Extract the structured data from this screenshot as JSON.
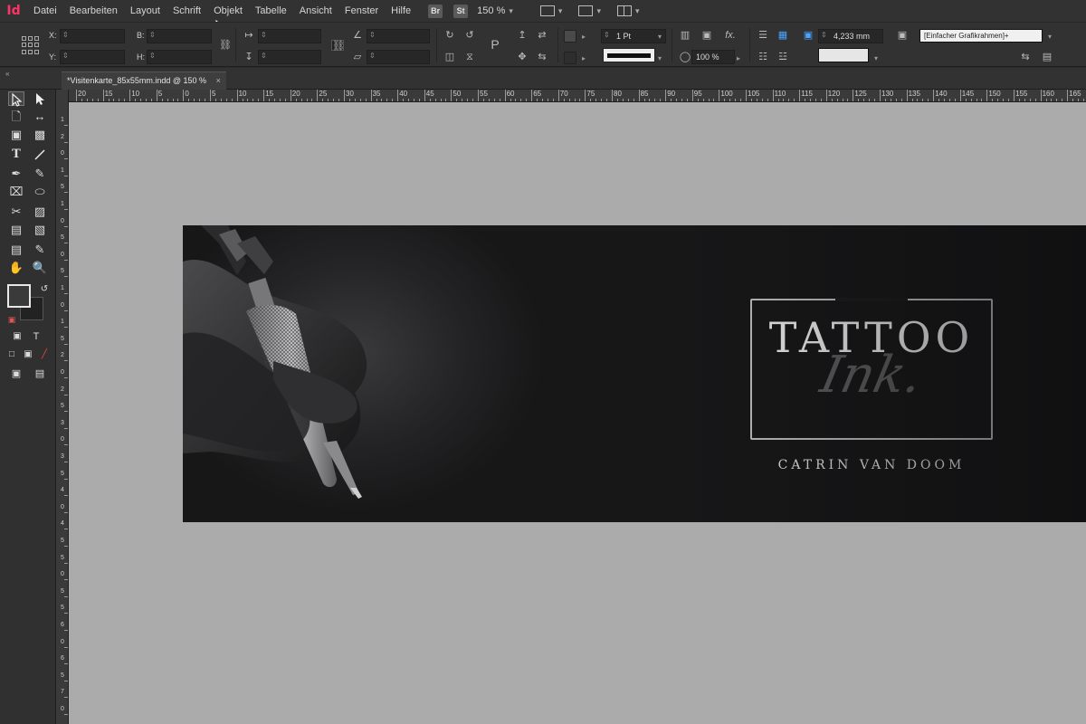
{
  "app": {
    "logo": "Id"
  },
  "menubar": {
    "items": [
      "Datei",
      "Bearbeiten",
      "Layout",
      "Schrift",
      "Objekt",
      "Tabelle",
      "Ansicht",
      "Fenster",
      "Hilfe"
    ],
    "bridge_label": "Br",
    "stock_label": "St",
    "zoom": "150 %"
  },
  "controlbar": {
    "x_label": "X:",
    "y_label": "Y:",
    "w_label": "B:",
    "h_label": "H:",
    "stroke_weight": "1 Pt",
    "opacity": "100 %",
    "offset": "4,233 mm",
    "object_style": "[Einfacher Grafikrahmen]+",
    "fx_label": "fx."
  },
  "document": {
    "tab_title": "*Visitenkarte_85x55mm.indd @ 150 %",
    "close_glyph": "×"
  },
  "rulers": {
    "horizontal": [
      "20",
      "15",
      "10",
      "5",
      "0",
      "5",
      "10",
      "15",
      "20",
      "25",
      "30",
      "35",
      "40",
      "45",
      "50",
      "55",
      "60",
      "65",
      "70",
      "75",
      "80",
      "85",
      "90",
      "95",
      "100",
      "105",
      "110",
      "115",
      "120",
      "125",
      "130",
      "135",
      "140",
      "145",
      "150",
      "155",
      "160",
      "165"
    ],
    "vertical": [
      "1",
      "2",
      "0",
      "1",
      "5",
      "1",
      "0",
      "5",
      "0",
      "5",
      "1",
      "0",
      "1",
      "5",
      "2",
      "0",
      "2",
      "5",
      "3",
      "0",
      "3",
      "5",
      "4",
      "0",
      "4",
      "5",
      "5",
      "0",
      "5",
      "5",
      "6",
      "0",
      "6",
      "5",
      "7",
      "0"
    ]
  },
  "card": {
    "title": "TATTOO",
    "script": "Ink.",
    "name": "CATRIN VAN DOOM"
  },
  "colors": {
    "accent_logo": "#ff3366",
    "pasteboard": "#ababab",
    "card_bg": "#171718"
  },
  "icons": {
    "tools": [
      "selection-icon",
      "direct-selection-icon",
      "page-icon",
      "gap-icon",
      "content-collector-icon",
      "content-placer-icon",
      "type-icon",
      "line-icon",
      "pen-icon",
      "pencil-icon",
      "rectangle-frame-icon",
      "ellipse-icon",
      "scissors-icon",
      "free-transform-icon",
      "gradient-swatch-icon",
      "gradient-feather-icon",
      "note-icon",
      "eyedropper-icon",
      "hand-icon",
      "zoom-icon"
    ]
  }
}
